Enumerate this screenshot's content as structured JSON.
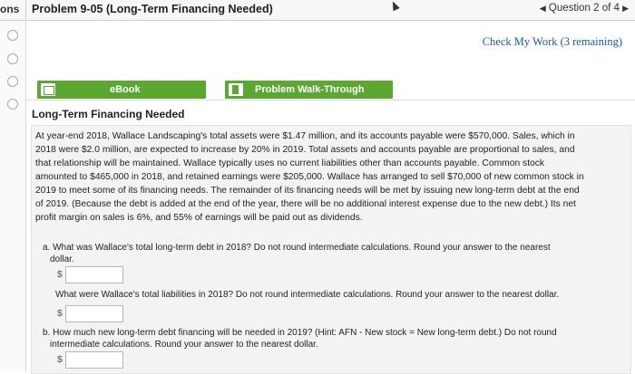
{
  "header": {
    "tab_fragment": "ons",
    "title": "Problem 9-05 (Long-Term Financing Needed)",
    "question_nav": "Question 2 of 4"
  },
  "check_work": "Check My Work (3 remaining)",
  "buttons": {
    "ebook": "eBook",
    "walkthrough": "Problem Walk-Through"
  },
  "problem": {
    "heading": "Long-Term Financing Needed",
    "paragraph_lines": [
      "At year-end 2018, Wallace Landscaping's total assets were $1.47 million, and its accounts payable were $570,000. Sales, which in",
      "2018 were $2.0 million, are expected to increase by 20% in 2019. Total assets and accounts payable are proportional to sales, and",
      "that relationship will be maintained. Wallace typically uses no current liabilities other than accounts payable. Common stock",
      "amounted to $465,000 in 2018, and retained earnings were $205,000. Wallace has arranged to sell $70,000 of new common stock in",
      "2019 to meet some of its financing needs. The remainder of its financing needs will be met by issuing new long-term debt at the end",
      "of 2019. (Because the debt is added at the end of the year, there will be no additional interest expense due to the new debt.) Its net",
      "profit margin on sales is 6%, and 55% of earnings will be paid out as dividends."
    ]
  },
  "questions": {
    "a1_line1": "a. What was Wallace's total long-term debt in 2018? Do not round intermediate calculations. Round your answer to the nearest",
    "a1_line2": "dollar.",
    "a2": "What were Wallace's total liabilities in 2018? Do not round intermediate calculations. Round your answer to the nearest dollar.",
    "b_line1": "b. How much new long-term debt financing will be needed in 2019? (Hint: AFN - New stock = New long-term debt.) Do not round",
    "b_line2": "intermediate calculations. Round your answer to the nearest dollar.",
    "currency": "$",
    "a1_value": "",
    "a2_value": "",
    "b_value": ""
  }
}
